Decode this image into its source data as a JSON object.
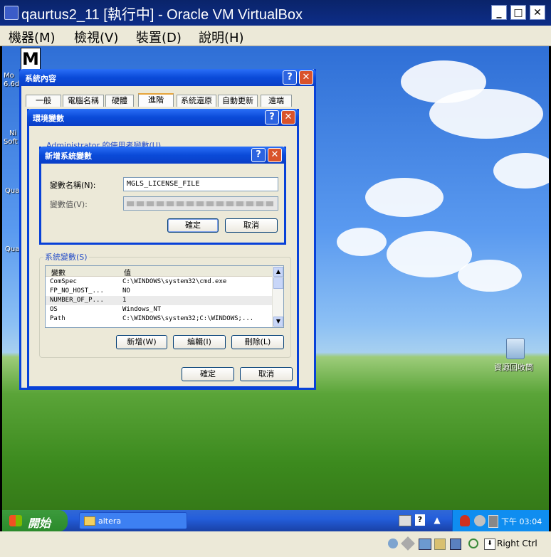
{
  "vbox": {
    "title": "qaurtus2_11 [執行中] - Oracle VM VirtualBox",
    "window_buttons": [
      "_",
      "□",
      "✕"
    ],
    "menu": [
      "機器(M)",
      "檢視(V)",
      "裝置(D)",
      "說明(H)"
    ]
  },
  "desktop": {
    "recycle_bin_label": "資源回收筒",
    "left_icon_labels": [
      "Mo",
      "6.6d",
      "Ni",
      "Soft",
      "Qua",
      "Qua"
    ]
  },
  "sysprop": {
    "title": "系統內容",
    "tabs": [
      "一般",
      "電腦名稱",
      "硬體",
      "進階",
      "系統還原",
      "自動更新",
      "遠端"
    ],
    "active_tab": "進階"
  },
  "envvars": {
    "title": "環境變數",
    "user_section_label": "Administrator 的使用者變數(U)",
    "sys_section_label": "系統變數(S)",
    "columns": [
      "變數",
      "值"
    ],
    "rows": [
      {
        "name": "ComSpec",
        "value": "C:\\WINDOWS\\system32\\cmd.exe"
      },
      {
        "name": "FP_NO_HOST_...",
        "value": "NO"
      },
      {
        "name": "NUMBER_OF_P...",
        "value": "1"
      },
      {
        "name": "OS",
        "value": "Windows_NT"
      },
      {
        "name": "Path",
        "value": "C:\\WINDOWS\\system32;C:\\WINDOWS;..."
      }
    ],
    "buttons": {
      "new": "新增(W)",
      "edit": "編輯(I)",
      "delete": "刪除(L)",
      "ok": "確定",
      "cancel": "取消"
    }
  },
  "newvar": {
    "title": "新增系統變數",
    "name_label": "變數名稱(N):",
    "name_value": "MGLS_LICENSE_FILE",
    "value_label": "變數值(V):",
    "value_value": "",
    "ok": "確定",
    "cancel": "取消"
  },
  "taskbar": {
    "start_label": "開始",
    "task_label": "altera",
    "clock": "下午 03:04"
  },
  "statusbar": {
    "host_key": "Right Ctrl"
  }
}
